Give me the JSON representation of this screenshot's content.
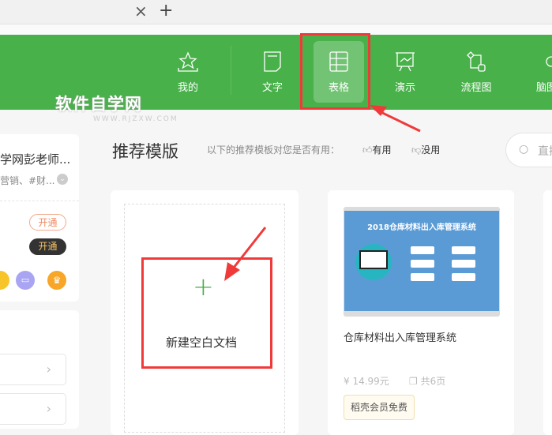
{
  "tabs": {
    "close": "×",
    "new": "+"
  },
  "nav": [
    {
      "label": "我的",
      "icon": "star-icon"
    },
    {
      "label": "文字",
      "icon": "document-icon"
    },
    {
      "label": "表格",
      "icon": "table-icon"
    },
    {
      "label": "演示",
      "icon": "presentation-icon"
    },
    {
      "label": "流程图",
      "icon": "flowchart-icon"
    },
    {
      "label": "脑图",
      "icon": "mindmap-icon"
    }
  ],
  "watermark": {
    "title": "软件自学网",
    "url": "WWW.RJZXW.COM"
  },
  "sidebar": {
    "user_name": "学网彭老师...",
    "tags": "营销、#财...",
    "open1": "开通",
    "open2": "开通"
  },
  "main": {
    "title": "推荐模版",
    "feedback_prompt": "以下的推荐模板对您是否有用：",
    "useful": "有用",
    "useless": "没用",
    "search_placeholder": "直接"
  },
  "blank": {
    "plus": "+",
    "label": "新建空白文档"
  },
  "template": {
    "thumb_title": "2018仓库材料出入库管理系统",
    "name": "仓库材料出入库管理系统",
    "price": "14.99元",
    "pages": "共6页",
    "badge": "稻壳会员免费"
  }
}
